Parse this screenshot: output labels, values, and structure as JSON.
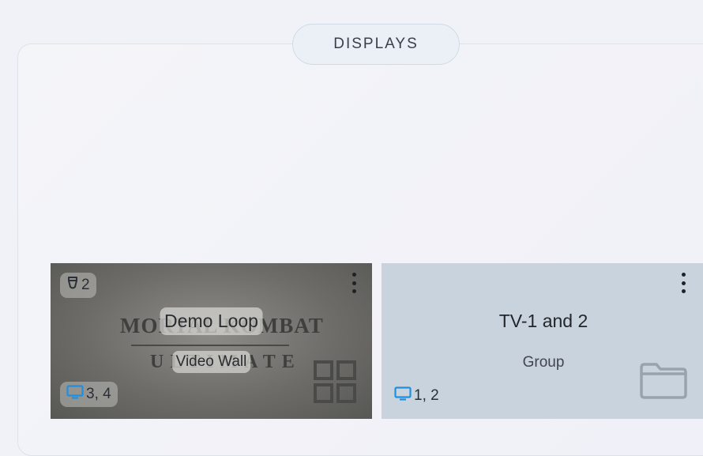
{
  "section": {
    "title": "DISPLAYS"
  },
  "cards": [
    {
      "title": "Demo Loop",
      "type": "Video Wall",
      "priority": "2",
      "displays": "3, 4",
      "background_art": {
        "line1": "MORTAL KOMBAT",
        "line2": "ULTIMATE"
      },
      "type_icon": "grid-icon"
    },
    {
      "title": "TV-1 and 2",
      "type": "Group",
      "displays": "1, 2",
      "type_icon": "folder-icon"
    }
  ],
  "colors": {
    "accent_blue": "#1f8fe0",
    "card_group_bg": "#c9d3dd",
    "pill_bg": "#eaf0f6"
  }
}
